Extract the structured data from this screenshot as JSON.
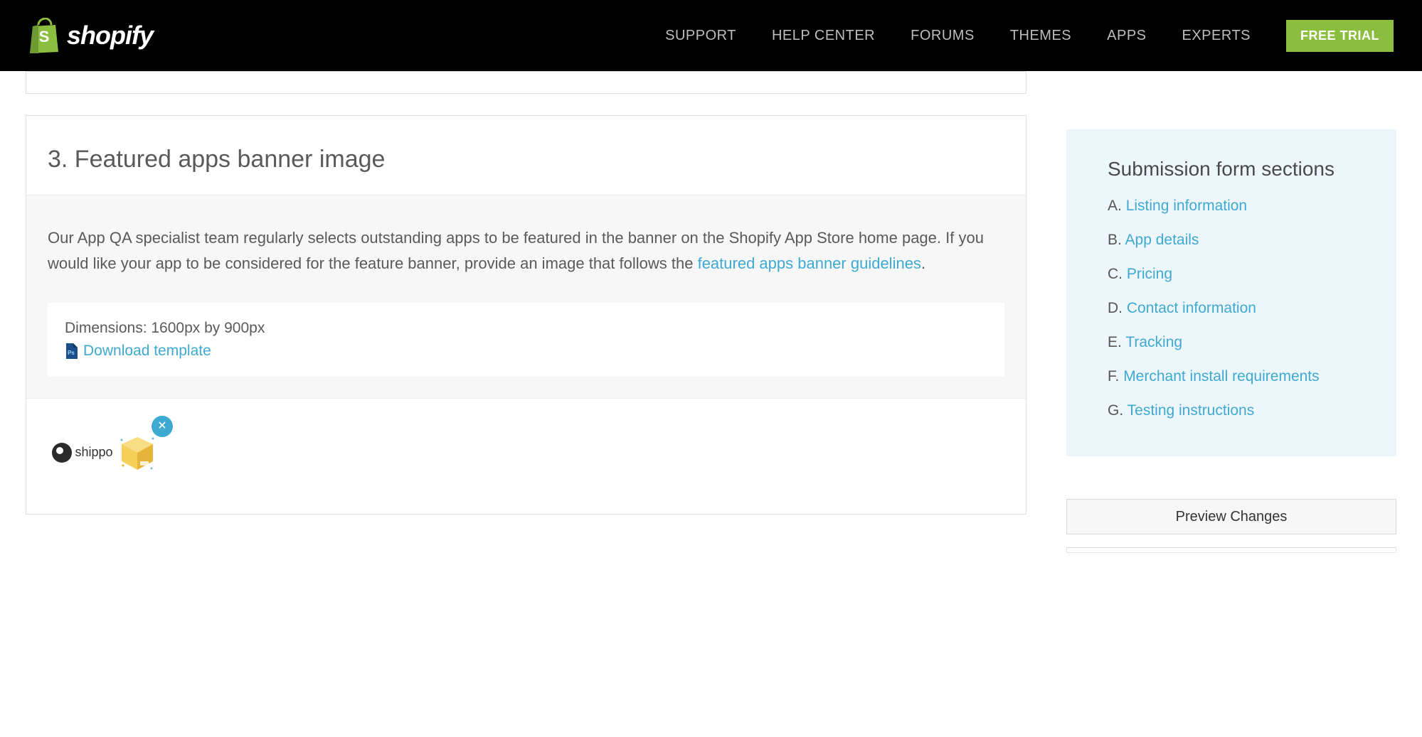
{
  "brand": {
    "name": "shopify"
  },
  "nav": {
    "items": [
      "SUPPORT",
      "HELP CENTER",
      "FORUMS",
      "THEMES",
      "APPS",
      "EXPERTS"
    ],
    "cta": "FREE TRIAL"
  },
  "section": {
    "title": "3. Featured apps banner image",
    "body_text_before_link": "Our App QA specialist team regularly selects outstanding apps to be featured in the banner on the Shopify App Store home page. If you would like your app to be considered for the feature banner, provide an image that follows the ",
    "body_link_text": "featured apps banner guidelines",
    "body_text_after_link": ".",
    "dimensions_label": "Dimensions: 1600px by 900px",
    "download_label": "Download template",
    "uploaded_thumb": {
      "brand_text": "shippo"
    }
  },
  "sidebar": {
    "title": "Submission form sections",
    "items": [
      {
        "letter": "A.",
        "label": "Listing information"
      },
      {
        "letter": "B.",
        "label": "App details"
      },
      {
        "letter": "C.",
        "label": "Pricing"
      },
      {
        "letter": "D.",
        "label": "Contact information"
      },
      {
        "letter": "E.",
        "label": "Tracking"
      },
      {
        "letter": "F.",
        "label": "Merchant install requirements"
      },
      {
        "letter": "G.",
        "label": "Testing instructions"
      }
    ],
    "preview_button": "Preview Changes"
  }
}
